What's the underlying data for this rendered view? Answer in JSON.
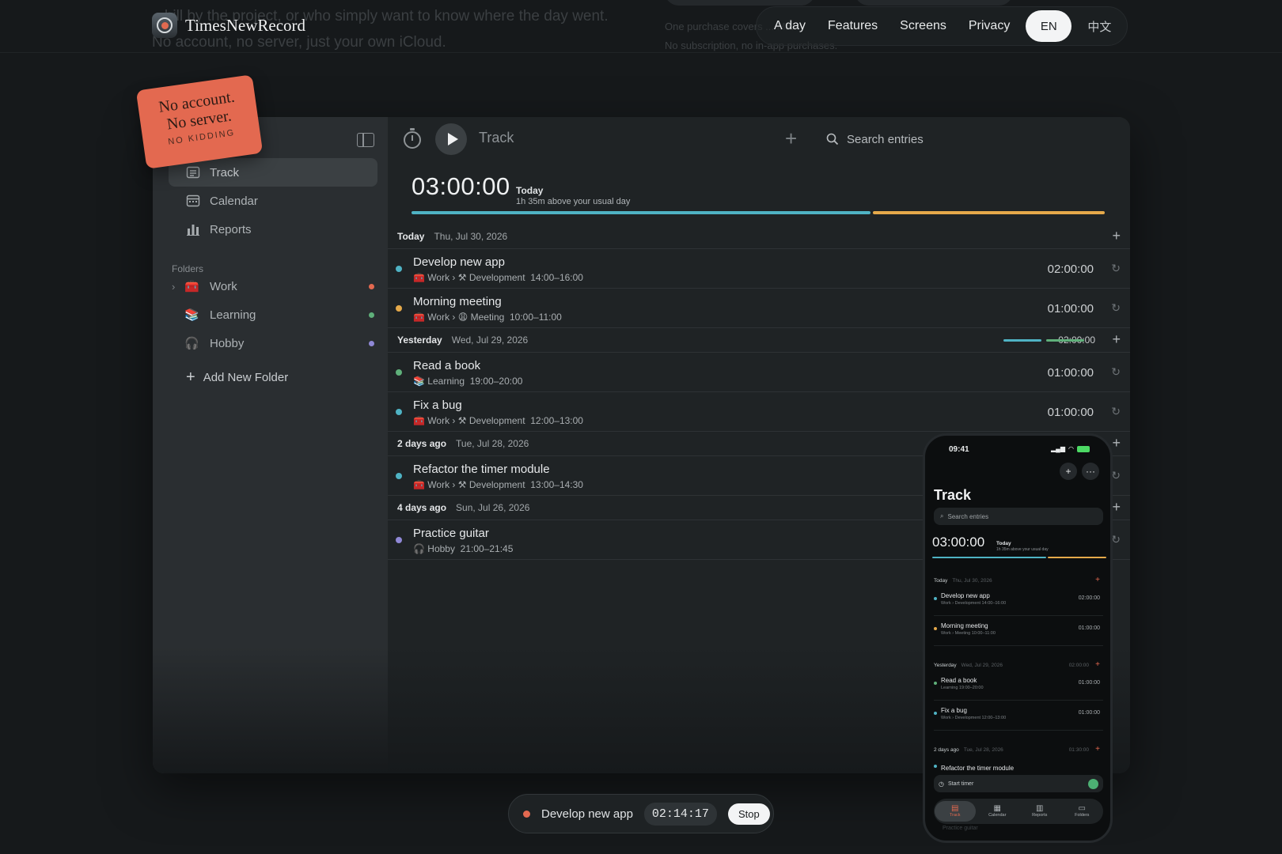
{
  "bg": {
    "left_text": "...hill by the project, or who simply want to know where the day went. No account, no server, just your own iCloud.",
    "right_line1": "One purchase covers ... Ma...",
    "right_line2": "No subscription, no in-app purchases."
  },
  "brand": {
    "name": "TimesNewRecord"
  },
  "nav": {
    "items": [
      "A day",
      "Features",
      "Screens",
      "Privacy"
    ],
    "lang_en": "EN",
    "lang_zh": "中文"
  },
  "sticker": {
    "line1": "No account.",
    "line2": "No server.",
    "line3": "NO KIDDING"
  },
  "sidebar": {
    "items": [
      {
        "label": "Track"
      },
      {
        "label": "Calendar"
      },
      {
        "label": "Reports"
      }
    ],
    "folders_heading": "Folders",
    "folders": [
      {
        "label": "Work",
        "icon": "🧰",
        "color": "#e36950"
      },
      {
        "label": "Learning",
        "icon": "📚",
        "color": "#5fb07a"
      },
      {
        "label": "Hobby",
        "icon": "🎧",
        "color": "#8f88d6"
      }
    ],
    "add_folder": "Add New Folder"
  },
  "toolbar": {
    "title": "Track",
    "search_placeholder": "Search entries"
  },
  "summary": {
    "total": "03:00:00",
    "label": "Today",
    "sub": "1h 35m above your usual day",
    "progress_fraction": 0.665
  },
  "sections": [
    {
      "label": "Today",
      "date": "Thu, Jul 30, 2026",
      "total": "",
      "entries": [
        {
          "title": "Develop new app",
          "folder_icon": "🧰",
          "folder": "Work",
          "tag_icon": "⚒",
          "tag": "Development",
          "time": "14:00–16:00",
          "duration": "02:00:00",
          "color": "#4fb3c4"
        },
        {
          "title": "Morning meeting",
          "folder_icon": "🧰",
          "folder": "Work",
          "tag_icon": "😩",
          "tag": "Meeting",
          "time": "10:00–11:00",
          "duration": "01:00:00",
          "color": "#e5a94a"
        }
      ]
    },
    {
      "label": "Yesterday",
      "date": "Wed, Jul 29, 2026",
      "total": "02:00:00",
      "entries": [
        {
          "title": "Read a book",
          "folder_icon": "📚",
          "folder": "Learning",
          "tag_icon": "",
          "tag": "",
          "time": "19:00–20:00",
          "duration": "01:00:00",
          "color": "#5fb07a"
        },
        {
          "title": "Fix a bug",
          "folder_icon": "🧰",
          "folder": "Work",
          "tag_icon": "⚒",
          "tag": "Development",
          "time": "12:00–13:00",
          "duration": "01:00:00",
          "color": "#4fb3c4"
        }
      ]
    },
    {
      "label": "2 days ago",
      "date": "Tue, Jul 28, 2026",
      "total": "",
      "entries": [
        {
          "title": "Refactor the timer module",
          "folder_icon": "🧰",
          "folder": "Work",
          "tag_icon": "⚒",
          "tag": "Development",
          "time": "13:00–14:30",
          "duration": "",
          "color": "#4fb3c4"
        }
      ]
    },
    {
      "label": "4 days ago",
      "date": "Sun, Jul 26, 2026",
      "total": "",
      "entries": [
        {
          "title": "Practice guitar",
          "folder_icon": "🎧",
          "folder": "Hobby",
          "tag_icon": "",
          "tag": "",
          "time": "21:00–21:45",
          "duration": "",
          "color": "#8f88d6"
        }
      ]
    }
  ],
  "running": {
    "name": "Develop new app",
    "elapsed": "02:14:17",
    "stop_label": "Stop"
  },
  "phone": {
    "clock": "09:41",
    "title": "Track",
    "search_placeholder": "Search entries",
    "total": "03:00:00",
    "today_label": "Today",
    "today_sub": "1h 35m above your usual day",
    "sections": [
      {
        "label": "Today",
        "date": "Thu, Jul 30, 2026",
        "total": ""
      },
      {
        "label": "Yesterday",
        "date": "Wed, Jul 29, 2026",
        "total": "02:00:00"
      },
      {
        "label": "2 days ago",
        "date": "Tue, Jul 28, 2026",
        "total": "01:30:00"
      }
    ],
    "entries": [
      {
        "title": "Develop new app",
        "meta": "Work › Development 14:00–16:00",
        "duration": "02:00:00",
        "color": "#4fb3c4"
      },
      {
        "title": "Morning meeting",
        "meta": "Work › Meeting 10:00–11:00",
        "duration": "01:00:00",
        "color": "#e5a94a"
      },
      {
        "title": "Read a book",
        "meta": "Learning 19:00–20:00",
        "duration": "01:00:00",
        "color": "#5fb07a"
      },
      {
        "title": "Fix a bug",
        "meta": "Work › Development 12:00–13:00",
        "duration": "01:00:00",
        "color": "#4fb3c4"
      },
      {
        "title": "Refactor the timer module",
        "meta": "",
        "duration": "",
        "color": "#4fb3c4"
      }
    ],
    "start_timer": "Start timer",
    "tabs": [
      "Track",
      "Calendar",
      "Reports",
      "Folders"
    ],
    "bottom_ghost": "Practice guitar"
  },
  "colors": {
    "accent": "#e36950",
    "teal": "#4fb3c4",
    "orange": "#e5a94a",
    "green": "#5fb07a",
    "purple": "#8f88d6"
  }
}
